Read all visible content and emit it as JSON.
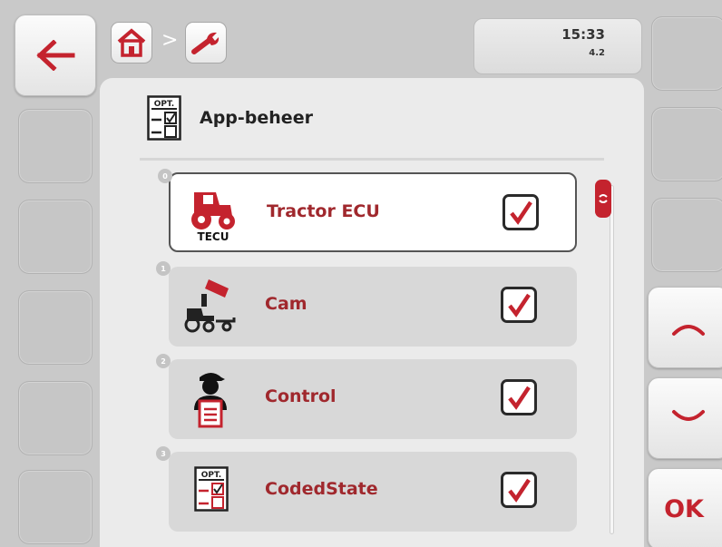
{
  "header": {
    "breadcrumb_separator": ">",
    "home_icon": "home-icon",
    "settings_icon": "wrench-icon",
    "time": "15:33",
    "version": "4.2"
  },
  "page": {
    "title": "App-beheer",
    "title_icon": "opt-checklist-icon"
  },
  "apps": [
    {
      "index": "0",
      "label": "Tractor ECU",
      "icon": "tractor-ecu-icon",
      "icon_caption": "TECU",
      "checked": true,
      "selected": true
    },
    {
      "index": "1",
      "label": "Cam",
      "icon": "camera-tractor-icon",
      "checked": true,
      "selected": false
    },
    {
      "index": "2",
      "label": "Control",
      "icon": "operator-clipboard-icon",
      "checked": true,
      "selected": false
    },
    {
      "index": "3",
      "label": "CodedState",
      "icon": "opt-checklist-icon",
      "checked": true,
      "selected": false
    }
  ],
  "softkeys": {
    "back_icon": "arrow-left-icon",
    "up_icon": "chevron-up-icon",
    "down_icon": "chevron-down-icon",
    "ok_label": "OK"
  },
  "colors": {
    "accent_red": "#c4232e",
    "label_red": "#a0282d",
    "background": "#c9c9c9"
  }
}
